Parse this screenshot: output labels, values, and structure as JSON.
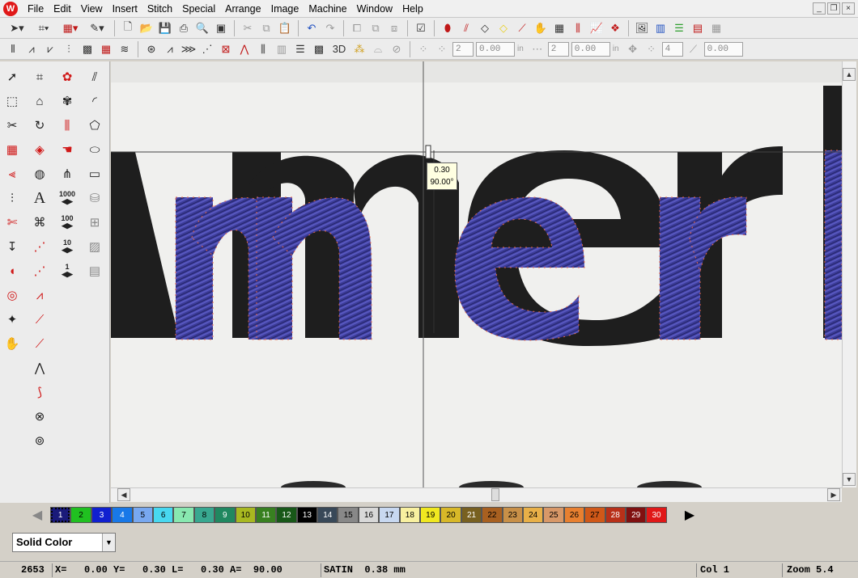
{
  "menu": [
    "File",
    "Edit",
    "View",
    "Insert",
    "Stitch",
    "Special",
    "Arrange",
    "Image",
    "Machine",
    "Window",
    "Help"
  ],
  "toolbar2": {
    "label_3d": "3D",
    "spin1": "2",
    "spin2": "0.00",
    "unit1": "in",
    "spin3": "2",
    "spin4": "0.00",
    "unit2": "in",
    "spin5": "4",
    "spin6": "0.00"
  },
  "left_tools": {
    "count_1000": "1000",
    "count_100": "100",
    "count_10": "10",
    "count_1": "1"
  },
  "canvas": {
    "tooltip_length": "0.30",
    "tooltip_angle": "90.00°"
  },
  "palette": [
    {
      "label": "1",
      "color": "#1a1a7a"
    },
    {
      "label": "2",
      "color": "#20c020"
    },
    {
      "label": "3",
      "color": "#1020d0"
    },
    {
      "label": "4",
      "color": "#1878e8"
    },
    {
      "label": "5",
      "color": "#78a8f0"
    },
    {
      "label": "6",
      "color": "#48d8f0"
    },
    {
      "label": "7",
      "color": "#88e8b0"
    },
    {
      "label": "8",
      "color": "#38a890"
    },
    {
      "label": "9",
      "color": "#208860"
    },
    {
      "label": "10",
      "color": "#a8b820"
    },
    {
      "label": "11",
      "color": "#388020"
    },
    {
      "label": "12",
      "color": "#185818"
    },
    {
      "label": "13",
      "color": "#000000"
    },
    {
      "label": "14",
      "color": "#384858"
    },
    {
      "label": "15",
      "color": "#888888"
    },
    {
      "label": "16",
      "color": "#d8d8d8"
    },
    {
      "label": "17",
      "color": "#c8d8f0"
    },
    {
      "label": "18",
      "color": "#f8f0a0"
    },
    {
      "label": "19",
      "color": "#f0e820"
    },
    {
      "label": "20",
      "color": "#d8b828"
    },
    {
      "label": "21",
      "color": "#786020"
    },
    {
      "label": "22",
      "color": "#a86020"
    },
    {
      "label": "23",
      "color": "#c89048"
    },
    {
      "label": "24",
      "color": "#e8b048"
    },
    {
      "label": "25",
      "color": "#d89868"
    },
    {
      "label": "26",
      "color": "#e88030"
    },
    {
      "label": "27",
      "color": "#d05818"
    },
    {
      "label": "28",
      "color": "#b83018"
    },
    {
      "label": "29",
      "color": "#801010"
    },
    {
      "label": "30",
      "color": "#e01818"
    }
  ],
  "color_mode": "Solid Color",
  "status": {
    "stitch_count": "2653",
    "coords": "X=   0.00 Y=   0.30 L=   0.30 A=  90.00",
    "stitch_type": "SATIN  0.38 mm",
    "color": "Col 1",
    "zoom": "Zoom 5.4"
  }
}
